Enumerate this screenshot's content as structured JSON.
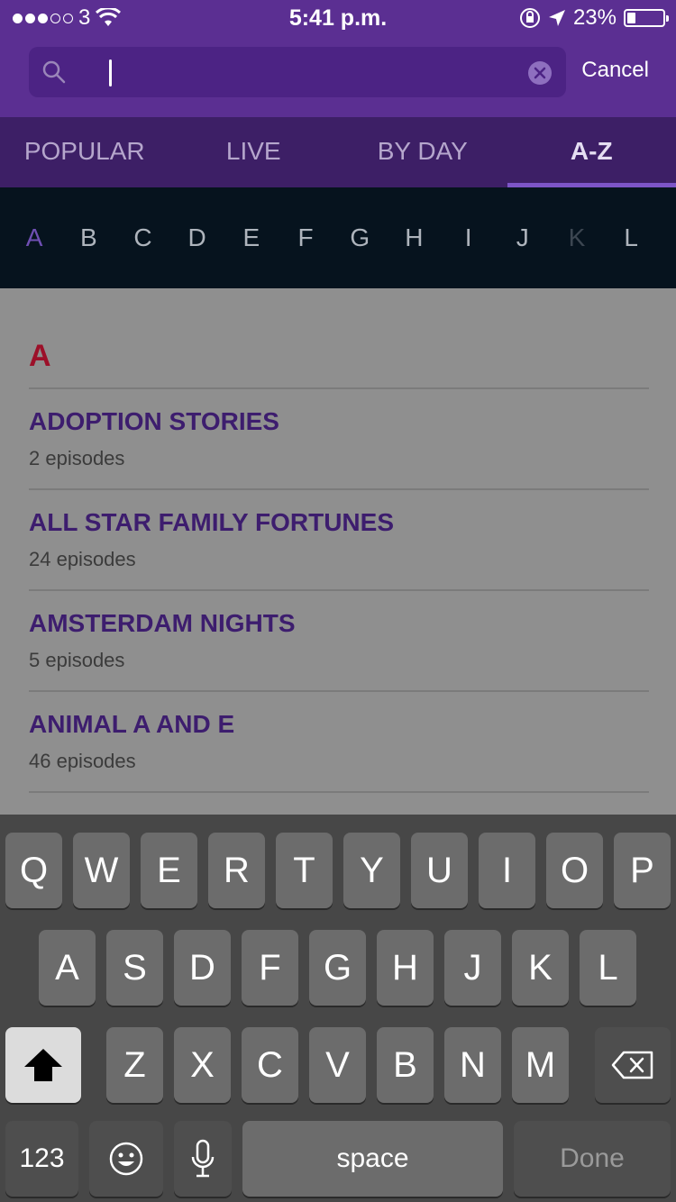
{
  "status": {
    "carrier": "3",
    "time": "5:41 p.m.",
    "battery_percent": "23%"
  },
  "search": {
    "value": "",
    "placeholder": "",
    "cancel_label": "Cancel"
  },
  "tabs": [
    {
      "label": "POPULAR",
      "active": false
    },
    {
      "label": "LIVE",
      "active": false
    },
    {
      "label": "BY DAY",
      "active": false
    },
    {
      "label": "A-Z",
      "active": true
    }
  ],
  "letters": [
    "A",
    "B",
    "C",
    "D",
    "E",
    "F",
    "G",
    "H",
    "I",
    "J",
    "K",
    "L"
  ],
  "letters_state": {
    "active": "A",
    "disabled": [
      "K"
    ]
  },
  "section": {
    "letter": "A"
  },
  "shows": [
    {
      "title": "ADOPTION STORIES",
      "episodes": "2 episodes"
    },
    {
      "title": "ALL STAR FAMILY FORTUNES",
      "episodes": "24 episodes"
    },
    {
      "title": "AMSTERDAM NIGHTS",
      "episodes": "5 episodes"
    },
    {
      "title": "ANIMAL A AND E",
      "episodes": "46 episodes"
    }
  ],
  "keyboard": {
    "row1": [
      "Q",
      "W",
      "E",
      "R",
      "T",
      "Y",
      "U",
      "I",
      "O",
      "P"
    ],
    "row2": [
      "A",
      "S",
      "D",
      "F",
      "G",
      "H",
      "J",
      "K",
      "L"
    ],
    "row3": [
      "Z",
      "X",
      "C",
      "V",
      "B",
      "N",
      "M"
    ],
    "numbers_label": "123",
    "space_label": "space",
    "done_label": "Done"
  },
  "colors": {
    "header": "#5b2f92",
    "tabs": "#3d1f66",
    "accent": "#7d55c7",
    "section_letter": "#9c1029",
    "show_title": "#3d1d6e"
  }
}
